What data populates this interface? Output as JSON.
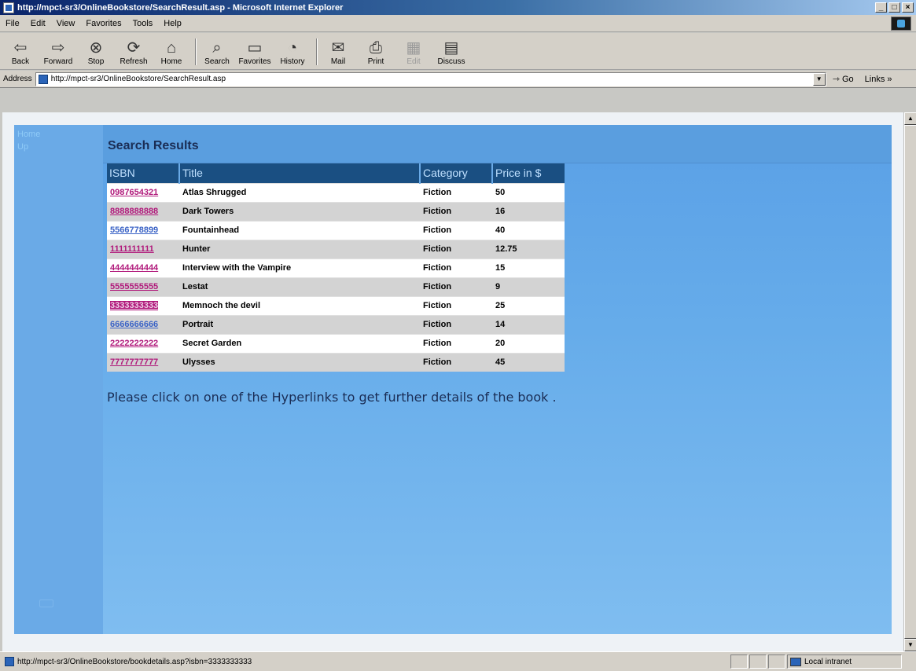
{
  "window": {
    "title": "http://mpct-sr3/OnlineBookstore/SearchResult.asp - Microsoft Internet Explorer"
  },
  "menu": [
    "File",
    "Edit",
    "View",
    "Favorites",
    "Tools",
    "Help"
  ],
  "toolbar": {
    "back": "Back",
    "forward": "Forward",
    "stop": "Stop",
    "refresh": "Refresh",
    "home": "Home",
    "search": "Search",
    "favorites": "Favorites",
    "history": "History",
    "mail": "Mail",
    "print": "Print",
    "edit": "Edit",
    "discuss": "Discuss"
  },
  "address": {
    "label": "Address",
    "url": "http://mpct-sr3/OnlineBookstore/SearchResult.asp",
    "go": "Go",
    "links": "Links »"
  },
  "nav": {
    "home": "Home",
    "up": "Up"
  },
  "page": {
    "title": "Search Results",
    "hint": "Please click on one of the Hyperlinks to get further details of the book ."
  },
  "table": {
    "headers": [
      "ISBN",
      "Title",
      "Category",
      "Price in $"
    ],
    "rows": [
      {
        "isbn": "0987654321",
        "title": "Atlas Shrugged",
        "category": "Fiction",
        "price": "50"
      },
      {
        "isbn": "8888888888",
        "title": "Dark Towers",
        "category": "Fiction",
        "price": "16"
      },
      {
        "isbn": "5566778899",
        "title": "Fountainhead",
        "category": "Fiction",
        "price": "40"
      },
      {
        "isbn": "1111111111",
        "title": "Hunter",
        "category": "Fiction",
        "price": "12.75"
      },
      {
        "isbn": "4444444444",
        "title": "Interview with the Vampire",
        "category": "Fiction",
        "price": "15"
      },
      {
        "isbn": "5555555555",
        "title": "Lestat",
        "category": "Fiction",
        "price": "9"
      },
      {
        "isbn": "3333333333",
        "title": "Memnoch the devil",
        "category": "Fiction",
        "price": "25"
      },
      {
        "isbn": "6666666666",
        "title": "Portrait",
        "category": "Fiction",
        "price": "14"
      },
      {
        "isbn": "2222222222",
        "title": "Secret Garden",
        "category": "Fiction",
        "price": "20"
      },
      {
        "isbn": "7777777777",
        "title": "Ulysses",
        "category": "Fiction",
        "price": "45"
      }
    ]
  },
  "status": {
    "text": "http://mpct-sr3/OnlineBookstore/bookdetails.asp?isbn=3333333333",
    "zone": "Local intranet"
  },
  "colors": {
    "link": "#b0187a",
    "visited_link": "#3b63c6",
    "header_bg": "#1a4f82",
    "panel": "#66acea",
    "title_text": "#1a2d55"
  }
}
